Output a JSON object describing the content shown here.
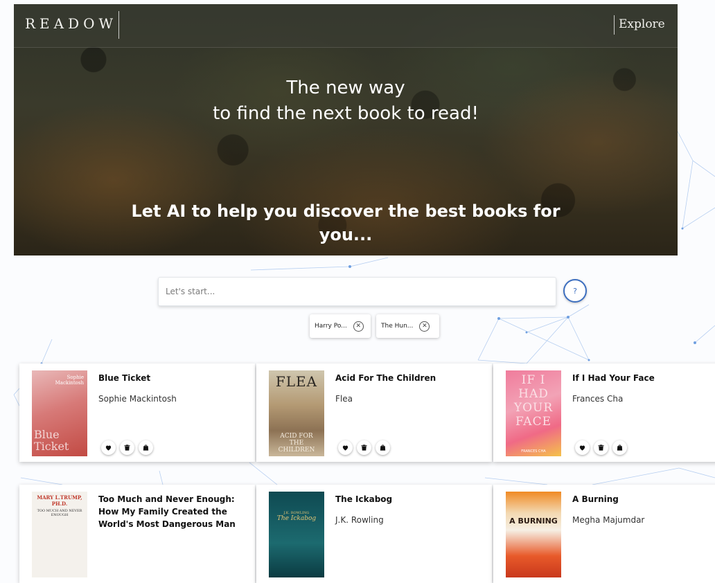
{
  "header": {
    "brand": "READOW",
    "nav_explore": "Explore"
  },
  "hero": {
    "title_line1": "The new way",
    "title_line2": "to find the next book to read!",
    "subtitle_line1": "Let AI to help you discover the best books for",
    "subtitle_line2": "you..."
  },
  "search": {
    "placeholder": "Let's start...",
    "value": "",
    "help_label": "?"
  },
  "chips": [
    {
      "label": "Harry Po..."
    },
    {
      "label": "The Hun..."
    }
  ],
  "books": [
    {
      "title": "Blue Ticket",
      "author": "Sophie Mackintosh",
      "cover_top": "Sophie\nMackintosh",
      "cover_text": "Blue\nTicket"
    },
    {
      "title": "Acid For The Children",
      "author": "Flea",
      "cover_top": "FLEA",
      "cover_text": "ACID FOR\nTHE\nCHILDREN"
    },
    {
      "title": "If I Had Your Face",
      "author": "Frances Cha",
      "cover_text": "IF I\nHAD\nYOUR\nFACE",
      "cover_bottom": "FRANCES CHA"
    },
    {
      "title": "Too Much and Never Enough: How My Family Created the World's Most Dangerous Man",
      "author": "",
      "cover_top": "MARY L.TRUMP, PH.D.",
      "cover_text": "TOO MUCH AND NEVER ENOUGH"
    },
    {
      "title": "The Ickabog",
      "author": "J.K. Rowling",
      "cover_top": "J.K. ROWLING",
      "cover_text": "The Ickabog"
    },
    {
      "title": "A Burning",
      "author": "Megha Majumdar",
      "cover_text": "A BURNING"
    }
  ],
  "actions": {
    "like_icon": "heart-icon",
    "delete_icon": "trash-icon",
    "buy_icon": "bag-icon"
  },
  "colors": {
    "accent": "#3d6fc0",
    "network": "#8fb4e8"
  }
}
